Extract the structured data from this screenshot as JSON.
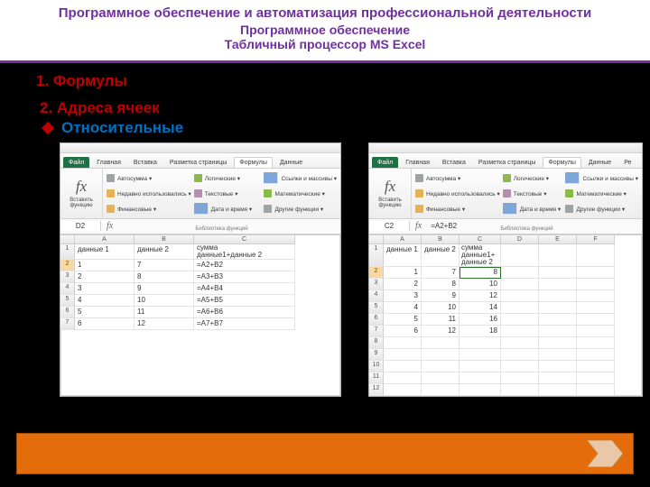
{
  "header": {
    "line1": "Программное обеспечение и автоматизация профессиональной деятельности",
    "line2": "Программное обеспечение",
    "line3": "Табличный процессор  MS Excel"
  },
  "list": {
    "item1": "1. Формулы",
    "item2": "2.  Адреса ячеек",
    "bullet": "Относительные"
  },
  "excel_common": {
    "file_tab": "Файл",
    "tabs": [
      "Главная",
      "Вставка",
      "Разметка страницы",
      "Формулы",
      "Данные"
    ],
    "tabs_right_extra": "Ре",
    "insert_fn": "Вставить функцию",
    "lib_caption": "Библиотека функций",
    "ribbon_items": [
      "Автосумма ▾",
      "Логические ▾",
      "Ссылки и массивы ▾",
      "Недавно использовались ▾",
      "Текстовые ▾",
      "Математические ▾",
      "Финансовые ▾",
      "Дата и время ▾",
      "Другие функции ▾"
    ]
  },
  "excel_left": {
    "active_cell": "D2",
    "formula_bar": "",
    "cols": [
      "A",
      "B",
      "C"
    ],
    "header_row": {
      "a": "данные 1",
      "b": "данные 2",
      "c1": "сумма",
      "c2": "данные1+данные 2"
    },
    "rows": [
      {
        "n": "2",
        "a": "1",
        "b": "7",
        "c": "=A2+B2"
      },
      {
        "n": "3",
        "a": "2",
        "b": "8",
        "c": "=A3+B3"
      },
      {
        "n": "4",
        "a": "3",
        "b": "9",
        "c": "=A4+B4"
      },
      {
        "n": "5",
        "a": "4",
        "b": "10",
        "c": "=A5+B5"
      },
      {
        "n": "6",
        "a": "5",
        "b": "11",
        "c": "=A6+B6"
      },
      {
        "n": "7",
        "a": "6",
        "b": "12",
        "c": "=A7+B7"
      }
    ]
  },
  "excel_right": {
    "active_cell": "C2",
    "formula_bar": "=A2+B2",
    "cols": [
      "A",
      "B",
      "C",
      "D",
      "E",
      "F"
    ],
    "header_row": {
      "a": "данные 1",
      "b": "данные 2",
      "c1": "сумма",
      "c2": "данные1+",
      "c3": "данные 2"
    },
    "rows": [
      {
        "n": "2",
        "a": "1",
        "b": "7",
        "c": "8"
      },
      {
        "n": "3",
        "a": "2",
        "b": "8",
        "c": "10"
      },
      {
        "n": "4",
        "a": "3",
        "b": "9",
        "c": "12"
      },
      {
        "n": "5",
        "a": "4",
        "b": "10",
        "c": "14"
      },
      {
        "n": "6",
        "a": "5",
        "b": "11",
        "c": "16"
      },
      {
        "n": "7",
        "a": "6",
        "b": "12",
        "c": "18"
      },
      {
        "n": "8",
        "a": "",
        "b": "",
        "c": ""
      },
      {
        "n": "9",
        "a": "",
        "b": "",
        "c": ""
      },
      {
        "n": "10",
        "a": "",
        "b": "",
        "c": ""
      },
      {
        "n": "11",
        "a": "",
        "b": "",
        "c": ""
      },
      {
        "n": "12",
        "a": "",
        "b": "",
        "c": ""
      }
    ]
  }
}
